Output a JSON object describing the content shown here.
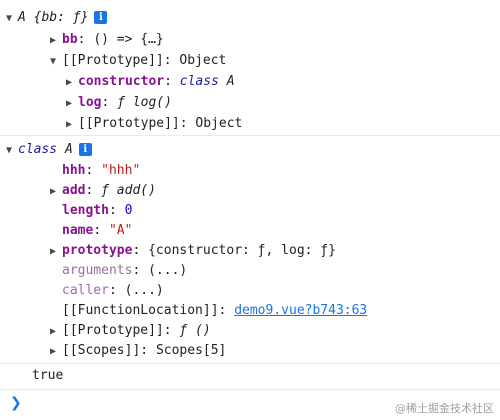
{
  "entry1": {
    "header_name": "A",
    "header_preview": "{bb: ƒ}",
    "info_badge": "i",
    "bb_key": "bb",
    "bb_val": "() => {…}",
    "proto_key": "[[Prototype]]",
    "proto_val": "Object",
    "constructor_key": "constructor",
    "constructor_kw": "class",
    "constructor_name": "A",
    "log_key": "log",
    "log_val": "ƒ log()",
    "inner_proto_key": "[[Prototype]]",
    "inner_proto_val": "Object"
  },
  "entry2": {
    "header_kw": "class",
    "header_name": "A",
    "info_badge": "i",
    "hhh_key": "hhh",
    "hhh_val": "\"hhh\"",
    "add_key": "add",
    "add_val": "ƒ add()",
    "length_key": "length",
    "length_val": "0",
    "name_key": "name",
    "name_val": "\"A\"",
    "prototype_key": "prototype",
    "prototype_val": "{constructor: ƒ, log: ƒ}",
    "arguments_key": "arguments",
    "arguments_val": "(...)",
    "caller_key": "caller",
    "caller_val": "(...)",
    "fnloc_key": "[[FunctionLocation]]",
    "fnloc_val": "demo9.vue?b743:63",
    "proto_key": "[[Prototype]]",
    "proto_val": "ƒ ()",
    "scopes_key": "[[Scopes]]",
    "scopes_val": "Scopes[5]"
  },
  "entry3": {
    "value": "true"
  },
  "prompt": {
    "caret": "❯"
  },
  "watermark": "@稀土掘金技术社区",
  "colors": {
    "key": "#881391",
    "string": "#c41a16",
    "number": "#1c00cf",
    "link": "#1a73e8",
    "badge": "#1a73e8"
  },
  "icons": {
    "expanded": "triangle-down-icon",
    "collapsed": "triangle-right-icon",
    "info": "info-icon",
    "prompt": "prompt-caret-icon"
  }
}
